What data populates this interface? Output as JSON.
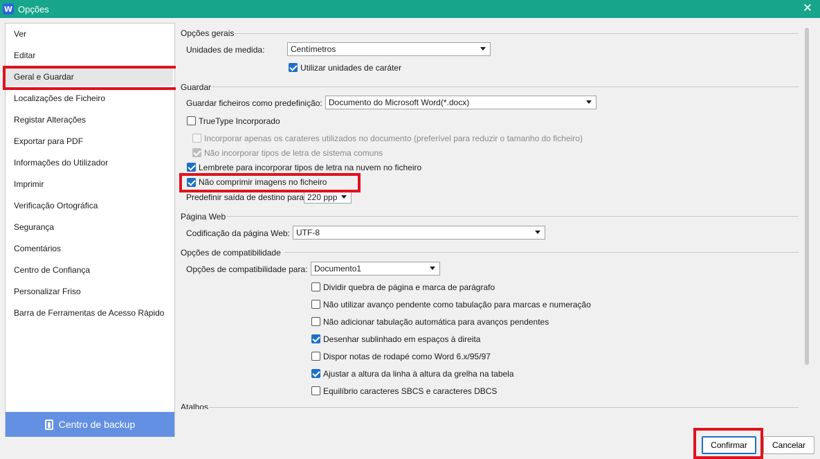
{
  "window": {
    "app_icon_letter": "W",
    "title": "Opções",
    "close_glyph": "✕"
  },
  "sidebar": {
    "items": [
      {
        "label": "Ver"
      },
      {
        "label": "Editar"
      },
      {
        "label": "Geral e Guardar",
        "selected": true
      },
      {
        "label": "Localizações de Ficheiro"
      },
      {
        "label": "Registar Alterações"
      },
      {
        "label": "Exportar para PDF"
      },
      {
        "label": "Informações do Utilizador"
      },
      {
        "label": "Imprimir"
      },
      {
        "label": "Verificação Ortográfica"
      },
      {
        "label": "Segurança"
      },
      {
        "label": "Comentários"
      },
      {
        "label": "Centro de Confiança"
      },
      {
        "label": "Personalizar Friso"
      },
      {
        "label": "Barra de Ferramentas de Acesso Rápido"
      }
    ],
    "backup_button": "Centro de backup"
  },
  "general": {
    "heading": "Opções gerais",
    "units_label": "Unidades de medida:",
    "units_value": "Centímetros",
    "char_units_label": "Utilizar unidades de caráter",
    "char_units_checked": true
  },
  "save": {
    "heading": "Guardar",
    "save_as_label": "Guardar ficheiros como predefinição:",
    "save_as_value": "Documento do Microsoft Word(*.docx)",
    "truetype_label": "TrueType Incorporado",
    "truetype_checked": false,
    "embed_used_label": "Incorporar apenas os carateres utilizados no documento (preferível para reduzir o tamanho do ficheiro)",
    "embed_used_checked": false,
    "no_system_fonts_label": "Não incorporar tipos de letra de sistema comuns",
    "no_system_fonts_checked": true,
    "cloud_reminder_label": "Lembrete para incorporar tipos de letra na nuvem no ficheiro",
    "cloud_reminder_checked": true,
    "no_compress_label": "Não comprimir imagens no ficheiro",
    "no_compress_checked": true,
    "default_output_label": "Predefinir saída de destino para:",
    "default_output_value": "220 ppp"
  },
  "web": {
    "heading": "Página Web",
    "encoding_label": "Codificação da página Web:",
    "encoding_value": "UTF-8"
  },
  "compat": {
    "heading": "Opções de compatibilidade",
    "for_label": "Opções de compatibilidade para:",
    "for_value": "Documento1",
    "options": [
      {
        "label": "Dividir quebra de página e marca de parágrafo",
        "checked": false
      },
      {
        "label": "Não utilizar avanço pendente como tabulação para marcas e numeração",
        "checked": false
      },
      {
        "label": "Não adicionar tabulação automática para avanços pendentes",
        "checked": false
      },
      {
        "label": "Desenhar sublinhado em espaços à direita",
        "checked": true
      },
      {
        "label": "Dispor notas de rodapé como Word 6.x/95/97",
        "checked": false
      },
      {
        "label": "Ajustar a altura da linha à altura da grelha na tabela",
        "checked": true
      },
      {
        "label": "Equilíbrio caracteres SBCS e caracteres DBCS",
        "checked": false
      }
    ]
  },
  "shortcuts": {
    "heading": "Atalhos"
  },
  "footer": {
    "confirm_label": "Confirmar",
    "cancel_label": "Cancelar"
  },
  "colors": {
    "titlebar": "#17a58c",
    "highlight": "#e0121e",
    "accent": "#1f6fc7",
    "backup": "#6390e3"
  }
}
